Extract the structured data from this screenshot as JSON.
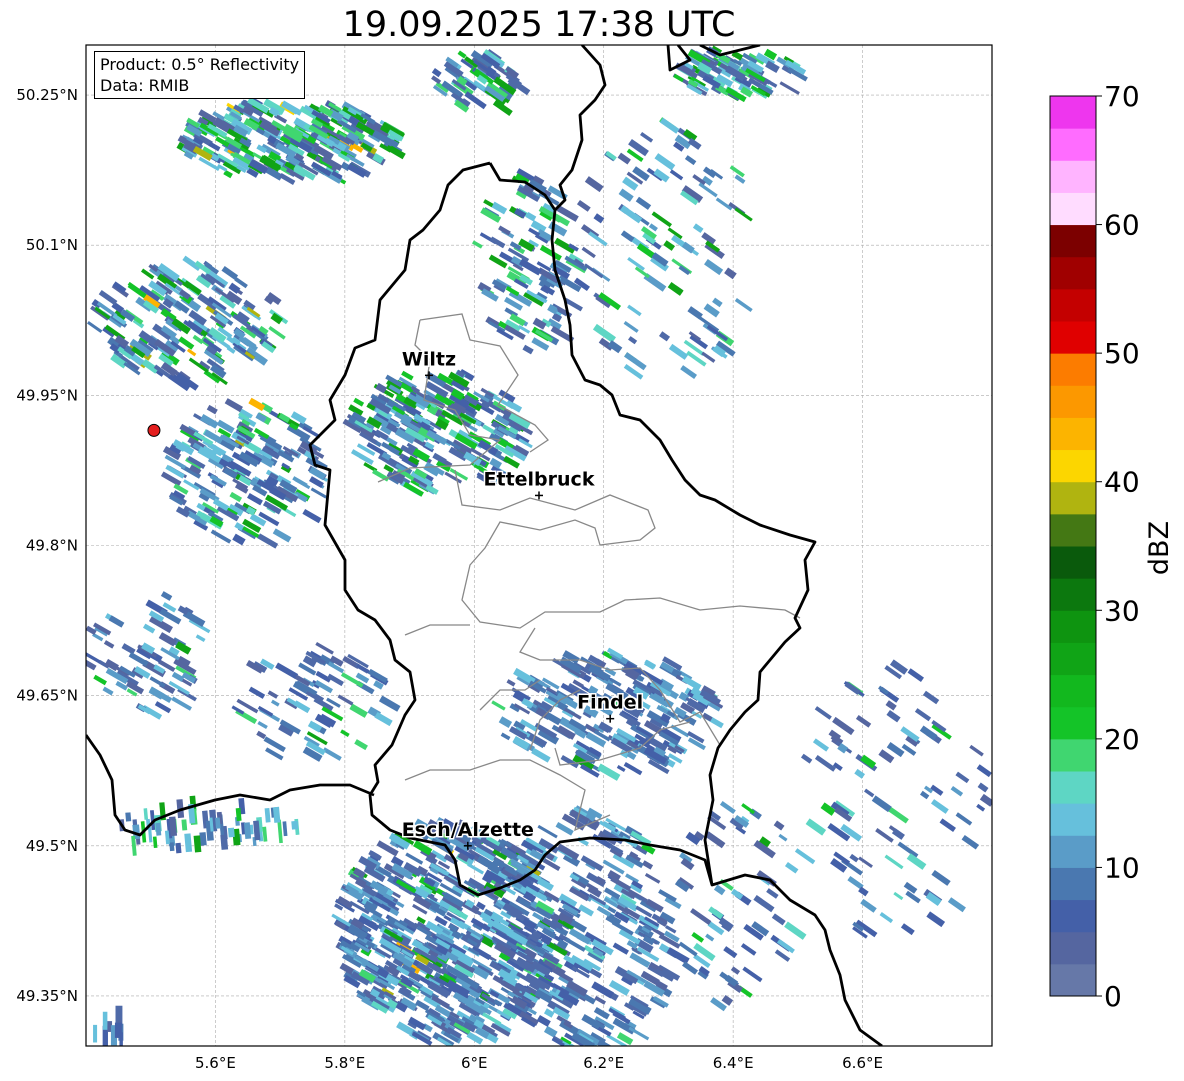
{
  "title": "19.09.2025 17:38 UTC",
  "info": {
    "product": "Product: 0.5° Reflectivity",
    "source": "Data: RMIB"
  },
  "map": {
    "lon_range": [
      5.4,
      6.8
    ],
    "lat_range": [
      49.3,
      50.3
    ],
    "lon_ticks": [
      {
        "value": 5.6,
        "label": "5.6°E"
      },
      {
        "value": 5.8,
        "label": "5.8°E"
      },
      {
        "value": 6.0,
        "label": "6°E"
      },
      {
        "value": 6.2,
        "label": "6.2°E"
      },
      {
        "value": 6.4,
        "label": "6.4°E"
      },
      {
        "value": 6.6,
        "label": "6.6°E"
      }
    ],
    "lat_ticks": [
      {
        "value": 50.25,
        "label": "50.25°N"
      },
      {
        "value": 50.1,
        "label": "50.1°N"
      },
      {
        "value": 49.95,
        "label": "49.95°N"
      },
      {
        "value": 49.8,
        "label": "49.8°N"
      },
      {
        "value": 49.65,
        "label": "49.65°N"
      },
      {
        "value": 49.5,
        "label": "49.5°N"
      },
      {
        "value": 49.35,
        "label": "49.35°N"
      }
    ],
    "cities": [
      {
        "name": "Wiltz",
        "lon": 5.93,
        "lat": 49.97
      },
      {
        "name": "Ettelbruck",
        "lon": 6.1,
        "lat": 49.85
      },
      {
        "name": "Findel",
        "lon": 6.21,
        "lat": 49.627
      },
      {
        "name": "Esch/Alzette",
        "lon": 5.99,
        "lat": 49.5
      }
    ],
    "radar_site": {
      "lon": 5.505,
      "lat": 49.915
    }
  },
  "colorbar": {
    "label": "dBZ",
    "min": 0,
    "max": 70,
    "ticks": [
      0,
      10,
      20,
      30,
      40,
      50,
      60,
      70
    ],
    "colors": [
      "#6678a8",
      "#5566a0",
      "#4460a8",
      "#4a78b0",
      "#5a9cc8",
      "#66c0dc",
      "#5ed6c4",
      "#40d670",
      "#14c428",
      "#12b81e",
      "#10a416",
      "#0e9410",
      "#0c780e",
      "#0a5a0c",
      "#447814",
      "#b0b410",
      "#fcd600",
      "#fcb400",
      "#fc9800",
      "#fc7c00",
      "#e00000",
      "#c40000",
      "#a00000",
      "#7c0000",
      "#ffdcff",
      "#ffb4ff",
      "#ff6cff",
      "#ee36ee"
    ]
  }
}
